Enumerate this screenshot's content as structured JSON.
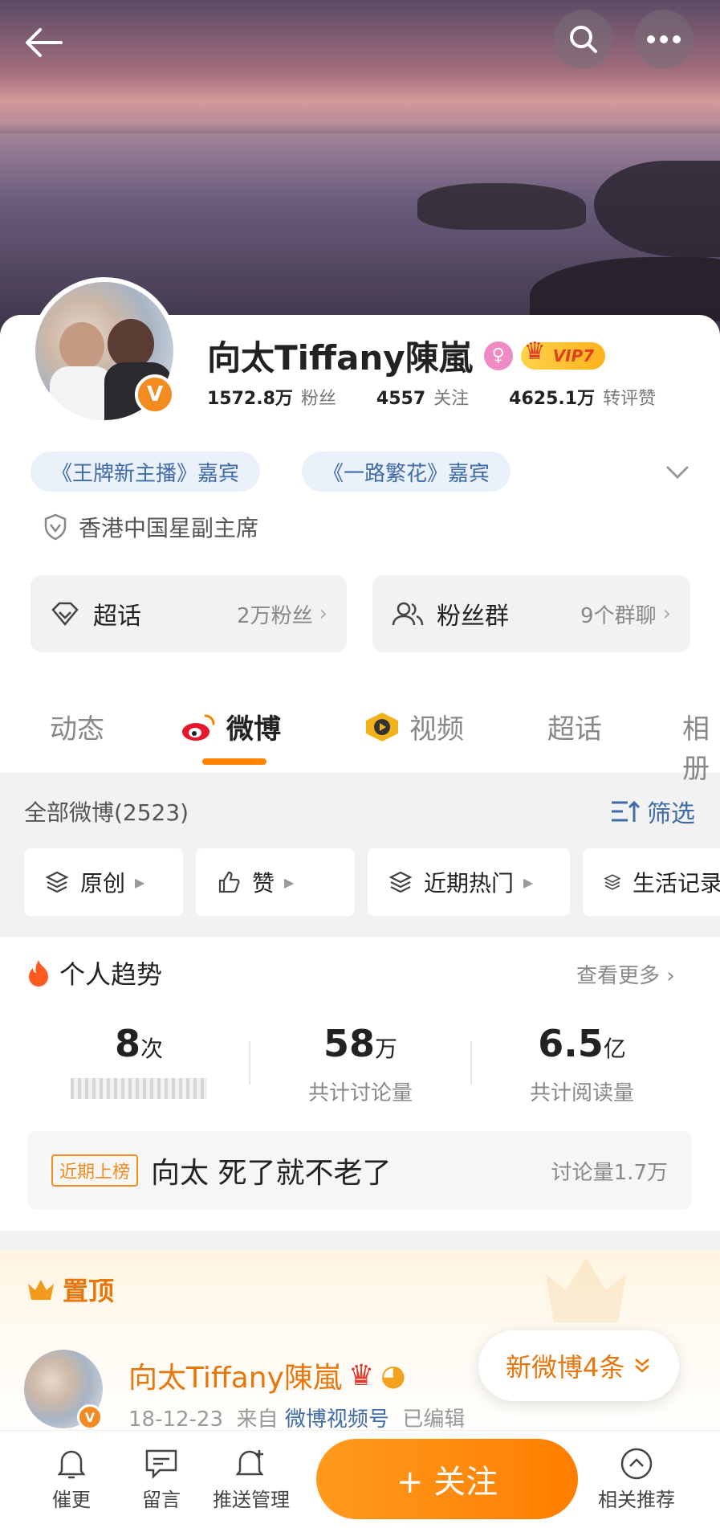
{
  "colors": {
    "accent": "#ff8200",
    "link": "#3f6ba8",
    "text": "#222222",
    "muted": "#888888",
    "gold": "#e8760a"
  },
  "profile": {
    "name": "向太Tiffany陳嵐",
    "vip_label": "VIP7",
    "stats": [
      {
        "value": "1572.8万",
        "label": "粉丝"
      },
      {
        "value": "4557",
        "label": "关注"
      },
      {
        "value": "4625.1万",
        "label": "转评赞"
      }
    ],
    "tags": [
      "《王牌新主播》嘉宾",
      "《一路繁花》嘉宾"
    ],
    "verification": "香港中国星副主席",
    "boxes": [
      {
        "title": "超话",
        "sub": "2万粉丝"
      },
      {
        "title": "粉丝群",
        "sub": "9个群聊"
      }
    ]
  },
  "tabs": [
    "动态",
    "微博",
    "视频",
    "超话",
    "相册"
  ],
  "feed": {
    "header": "全部微博(2523)",
    "filter_label": "筛选",
    "chips": [
      "原创",
      "赞",
      "近期热门",
      "生活记录"
    ]
  },
  "trend": {
    "title": "个人趋势",
    "more": "查看更多",
    "metrics": [
      {
        "value": "8",
        "unit": "次",
        "label": ""
      },
      {
        "value": "58",
        "unit": "万",
        "label": "共计讨论量"
      },
      {
        "value": "6.5",
        "unit": "亿",
        "label": "共计阅读量"
      }
    ],
    "hot": {
      "badge": "近期上榜",
      "text": "向太 死了就不老了",
      "count": "讨论量1.7万"
    }
  },
  "pinned": {
    "title": "置顶",
    "author": "向太Tiffany陳嵐",
    "date": "18-12-23",
    "from_label": "来自",
    "source": "微博视频号",
    "edited": "已编辑",
    "new_posts": "新微博4条"
  },
  "bottom_nav": {
    "items": [
      "催更",
      "留言",
      "推送管理"
    ],
    "follow": "+ 关注",
    "related": "相关推荐"
  }
}
